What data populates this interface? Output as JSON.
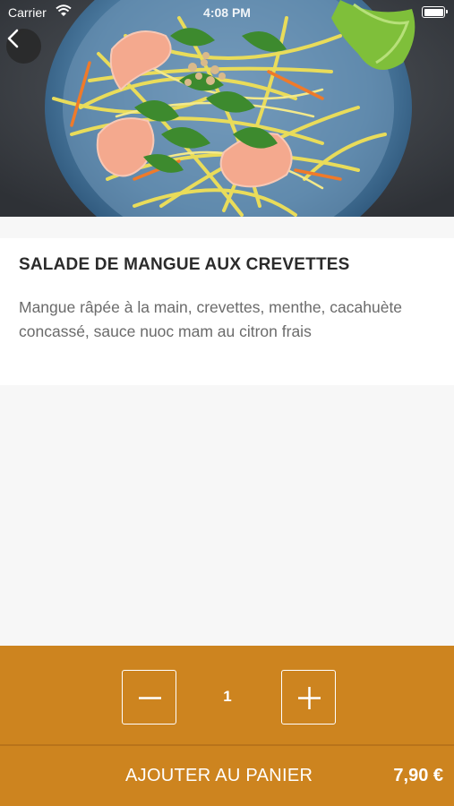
{
  "status_bar": {
    "carrier": "Carrier",
    "time": "4:08 PM",
    "icons": [
      "wifi-icon",
      "battery-icon"
    ]
  },
  "hero": {
    "image": "mango-shrimp-salad-photo",
    "back_icon": "chevron-left-icon"
  },
  "dish": {
    "title": "SALADE DE MANGUE AUX CREVETTES",
    "description": "Mangue râpée à la main, crevettes, menthe, cacahuète concassé, sauce nuoc mam au citron frais"
  },
  "order": {
    "decrement_icon": "minus-icon",
    "increment_icon": "plus-icon",
    "quantity": "1",
    "add_label": "AJOUTER AU PANIER",
    "price": "7,90 €"
  },
  "colors": {
    "accent": "#cd841f",
    "background": "#f7f7f7",
    "title": "#2b2b2b",
    "description": "#6b6b6b"
  }
}
